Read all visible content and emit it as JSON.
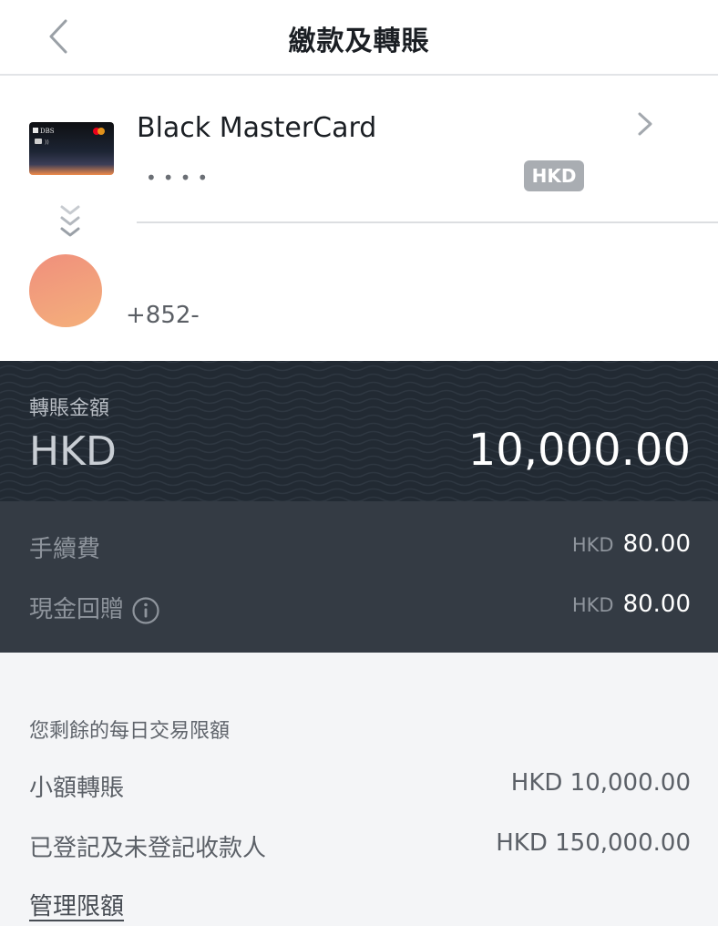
{
  "header": {
    "title": "繳款及轉賬",
    "back_icon": "chevron-left-icon"
  },
  "source_card": {
    "name": "Black MasterCard",
    "masked_number": "••••",
    "currency_badge": "HKD",
    "card_brand_text": "DBS"
  },
  "recipient": {
    "phone": "+852-"
  },
  "transfer": {
    "label": "轉賬金額",
    "currency": "HKD",
    "amount": "10,000.00"
  },
  "fees": [
    {
      "label": "手續費",
      "currency": "HKD",
      "amount": "80.00",
      "has_info": false
    },
    {
      "label": "現金回贈",
      "currency": "HKD",
      "amount": "80.00",
      "has_info": true
    }
  ],
  "limits": {
    "title": "您剩餘的每日交易限額",
    "rows": [
      {
        "label": "小額轉賬",
        "value": "HKD 10,000.00"
      },
      {
        "label": "已登記及未登記收款人",
        "value": "HKD 150,000.00"
      }
    ],
    "manage_label": "管理限額"
  },
  "colors": {
    "amount_bg": "#222a33",
    "fees_bg": "#343b44",
    "limits_bg": "#f4f5f7",
    "badge_bg": "#a9adb2"
  }
}
